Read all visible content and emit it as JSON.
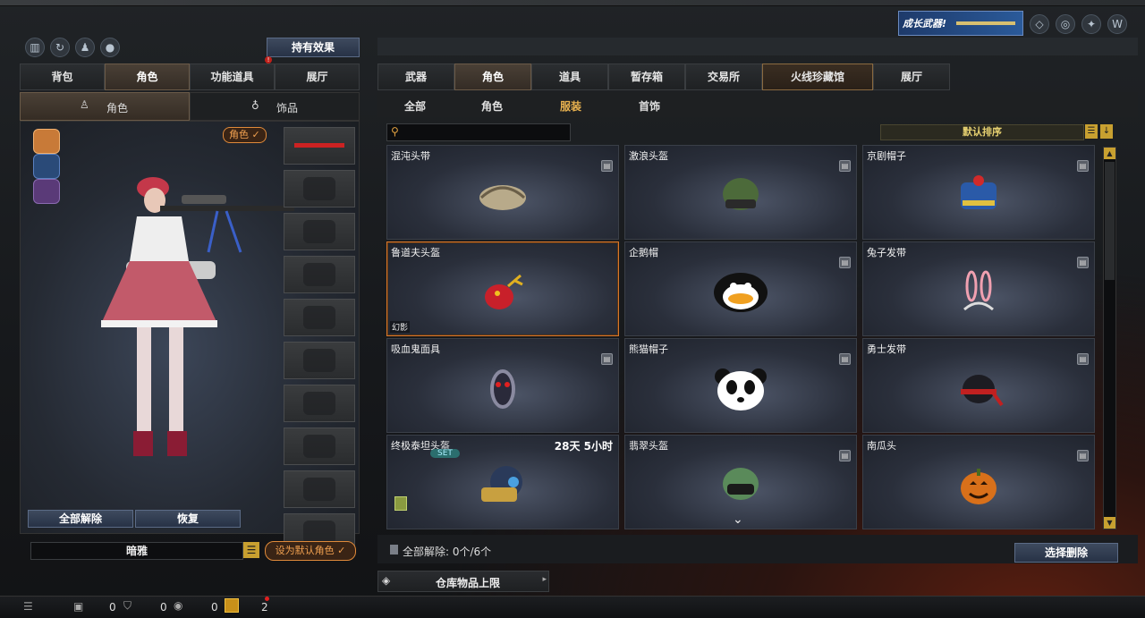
{
  "top_banner": {
    "text": "成长武器!"
  },
  "left": {
    "status_button": "持有效果",
    "tabs": [
      {
        "label": "背包",
        "active": false
      },
      {
        "label": "角色",
        "active": true
      },
      {
        "label": "功能道具",
        "active": false
      },
      {
        "label": "展厅",
        "active": false
      }
    ],
    "subtabs": [
      {
        "label": "角色",
        "active": true
      },
      {
        "label": "饰品",
        "active": false
      }
    ],
    "role_tag": "角色",
    "unequip_all_button": "全部解除",
    "restore_button": "恢复",
    "character_name": "暗雅",
    "set_default_button": "设为默认角色"
  },
  "right": {
    "tabs": [
      {
        "label": "武器",
        "active": false
      },
      {
        "label": "角色",
        "active": true
      },
      {
        "label": "道具",
        "active": false
      },
      {
        "label": "暂存箱",
        "active": false
      },
      {
        "label": "交易所",
        "active": false
      },
      {
        "label": "火线珍藏馆",
        "active": false
      },
      {
        "label": "展厅",
        "active": false
      }
    ],
    "subtabs": [
      {
        "label": "全部",
        "active": false
      },
      {
        "label": "角色",
        "active": false
      },
      {
        "label": "服装",
        "active": true
      },
      {
        "label": "首饰",
        "active": false
      }
    ],
    "search_placeholder": "",
    "sort_label": "默认排序",
    "items": [
      {
        "name": "混沌头带",
        "art": "headband",
        "selected": false,
        "timer": "",
        "badge": "",
        "set": ""
      },
      {
        "name": "激浪头盔",
        "art": "helmet-green",
        "selected": false,
        "timer": "",
        "badge": "",
        "set": ""
      },
      {
        "name": "京剧帽子",
        "art": "opera-hat",
        "selected": false,
        "timer": "",
        "badge": "",
        "set": ""
      },
      {
        "name": "鲁道夫头盔",
        "art": "reindeer",
        "selected": true,
        "timer": "",
        "badge": "幻影",
        "set": ""
      },
      {
        "name": "企鹅帽",
        "art": "penguin",
        "selected": false,
        "timer": "",
        "badge": "",
        "set": ""
      },
      {
        "name": "兔子发带",
        "art": "bunny",
        "selected": false,
        "timer": "",
        "badge": "",
        "set": ""
      },
      {
        "name": "吸血鬼面具",
        "art": "vampire",
        "selected": false,
        "timer": "",
        "badge": "",
        "set": ""
      },
      {
        "name": "熊猫帽子",
        "art": "panda",
        "selected": false,
        "timer": "",
        "badge": "",
        "set": ""
      },
      {
        "name": "勇士发带",
        "art": "warrior",
        "selected": false,
        "timer": "",
        "badge": "",
        "set": ""
      },
      {
        "name": "终极泰坦头盔",
        "art": "titan",
        "selected": false,
        "timer": "28天 5小时",
        "badge": "",
        "set": "SET"
      },
      {
        "name": "翡翠头盔",
        "art": "jade",
        "selected": false,
        "timer": "",
        "badge": "",
        "set": ""
      },
      {
        "name": "南瓜头",
        "art": "pumpkin",
        "selected": false,
        "timer": "",
        "badge": "",
        "set": ""
      }
    ],
    "unequip_status": "全部解除: 0个/6个",
    "select_delete_button": "选择删除",
    "storage_limit_button": "仓库物品上限"
  },
  "bottom_bar": {
    "counts": [
      "0",
      "0",
      "0"
    ],
    "notify_count": "2"
  }
}
